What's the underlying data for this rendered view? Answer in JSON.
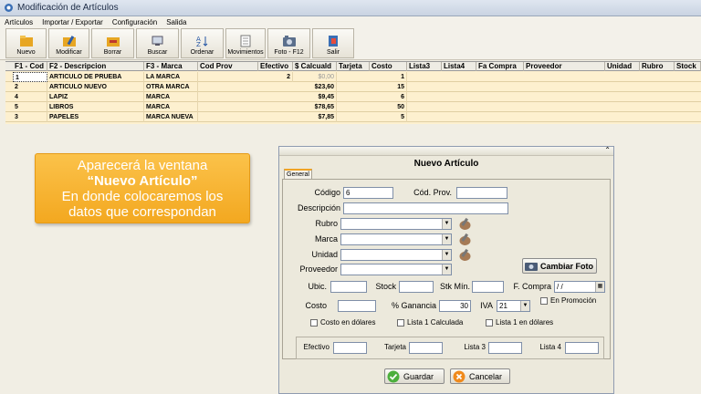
{
  "window": {
    "title": "Modificación de Artículos"
  },
  "menu": [
    "Artículos",
    "Importar / Exportar",
    "Configuración",
    "Salida"
  ],
  "toolbar": [
    {
      "label": "Nuevo",
      "icon": "new-folder-icon"
    },
    {
      "label": "Modificar",
      "icon": "edit-folder-icon"
    },
    {
      "label": "Borrar",
      "icon": "delete-folder-icon"
    },
    {
      "label": "Buscar",
      "icon": "search-icon"
    },
    {
      "label": "Ordenar",
      "icon": "sort-az-icon"
    },
    {
      "label": "Movimientos",
      "icon": "notepad-icon"
    },
    {
      "label": "Foto - F12",
      "icon": "photo-icon"
    },
    {
      "label": "Salir",
      "icon": "exit-icon"
    }
  ],
  "grid": {
    "headers": [
      "F1 - Cod",
      "F2 - Descripcion",
      "F3 - Marca",
      "Cod Prov",
      "Efectivo",
      "$ Calcuald",
      "Tarjeta",
      "Costo",
      "Lista3",
      "Lista4",
      "Fa Compra",
      "Proveedor",
      "Unidad",
      "Rubro",
      "Stock"
    ],
    "rows": [
      {
        "cod": "1",
        "desc": "ARTICULO DE PRUEBA",
        "marca": "LA MARCA",
        "efectivo": "2",
        "calc": "$0,00",
        "costo": "1"
      },
      {
        "cod": "2",
        "desc": "ARTICULO NUEVO",
        "marca": "OTRA MARCA",
        "efectivo": "",
        "calc": "$23,60",
        "costo": "15"
      },
      {
        "cod": "4",
        "desc": "LAPIZ",
        "marca": "MARCA",
        "efectivo": "",
        "calc": "$9,45",
        "costo": "6"
      },
      {
        "cod": "5",
        "desc": "LIBROS",
        "marca": "MARCA",
        "efectivo": "",
        "calc": "$78,65",
        "costo": "50"
      },
      {
        "cod": "3",
        "desc": "PAPELES",
        "marca": "MARCA NUEVA",
        "efectivo": "",
        "calc": "$7,85",
        "costo": "5"
      }
    ]
  },
  "callout": {
    "line1": "Aparecerá la ventana",
    "line2": "“Nuevo Artículo”",
    "line3": "En donde colocaremos los",
    "line4": "datos que correspondan"
  },
  "dialog": {
    "title": "Nuevo Artículo",
    "tab": "General",
    "labels": {
      "codigo": "Código",
      "cod_prov": "Cód. Prov.",
      "descripcion": "Descripción",
      "rubro": "Rubro",
      "marca": "Marca",
      "unidad": "Unidad",
      "proveedor": "Proveedor",
      "ubic": "Ubic.",
      "stock": "Stock",
      "stk_min": "Stk Mín.",
      "f_compra": "F. Compra",
      "costo": "Costo",
      "ganancia": "% Ganancia",
      "iva": "IVA",
      "efectivo": "Efectivo",
      "tarjeta": "Tarjeta",
      "lista3": "Lista 3",
      "lista4": "Lista 4"
    },
    "values": {
      "codigo": "6",
      "f_compra": "/ /",
      "ganancia": "30",
      "iva": "21"
    },
    "checks": {
      "en_promocion": "En Promoción",
      "costo_dolares": "Costo en dólares",
      "lista1_calculada": "Lista 1 Calculada",
      "lista1_dolares": "Lista 1 en dólares"
    },
    "buttons": {
      "cambiar_foto": "Cambiar Foto",
      "guardar": "Guardar",
      "cancelar": "Cancelar"
    }
  }
}
